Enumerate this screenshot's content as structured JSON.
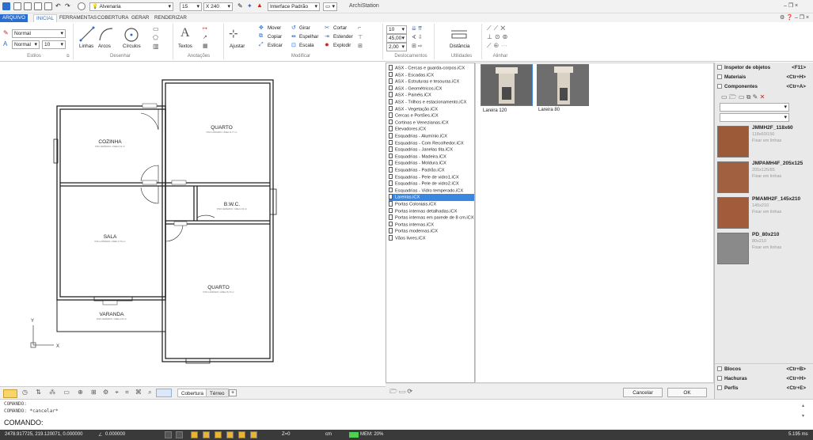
{
  "title": {
    "app": "ArchiStation",
    "layer": "Alvenaria",
    "thickness": "15",
    "height": "240",
    "interface": "Interface Padrão",
    "window_controls": "– ❐ ×"
  },
  "menu": {
    "file": "ARQUIVO",
    "tabs": [
      "INICIAL",
      "FERRAMENTAS",
      "COBERTURA",
      "GERAR",
      "RENDERIZAR"
    ]
  },
  "ribbon": {
    "styles": {
      "style1": "Normal",
      "style2": "Normal",
      "size": "10",
      "label": "Estilos"
    },
    "desenhar": {
      "linhas": "Linhas",
      "arcos": "Arcos",
      "circulos": "Círculos",
      "label": "Desenhar"
    },
    "anotacoes": {
      "textos": "Textos",
      "label": "Anotações"
    },
    "modificar": {
      "ajustar": "Ajustar",
      "mover": "Mover",
      "copiar": "Copiar",
      "esticar": "Esticar",
      "girar": "Girar",
      "espelhar": "Espelhar",
      "escala": "Escala",
      "cortar": "Cortar",
      "estender": "Estender",
      "explodir": "Explodir",
      "label": "Modificar"
    },
    "deslocamentos": {
      "v1": "10",
      "v2": "45,00",
      "v3": "2,00",
      "label": "Deslocamentos"
    },
    "utilidades": {
      "distancia": "Distância",
      "label": "Utilidades"
    },
    "alinhar": {
      "label": "Alinhar"
    }
  },
  "plan": {
    "rooms": {
      "cozinha": {
        "name": "COZINHA",
        "info": "PISO CERÂMICO / ÁREA 8,11 m²"
      },
      "quarto1": {
        "name": "QUARTO",
        "info": "PISO LAMINADO / ÁREA 11,77 m²"
      },
      "bwc": {
        "name": "B.W.C.",
        "info": "PISO CERÂMICO / ÁREA 2,30 m²"
      },
      "sala": {
        "name": "SALA",
        "info": "PISO LAMINADO / ÁREA 17,51 m²"
      },
      "quarto2": {
        "name": "QUARTO",
        "info": "PISO LAMINADO / ÁREA 15,74 m²"
      },
      "varanda": {
        "name": "VARANDA",
        "info": "PISO CERÂMICO / ÁREA 4,53 m²"
      }
    },
    "axis": {
      "x": "X",
      "y": "Y"
    }
  },
  "files": [
    "ASX - Cercas e guarda-corpos.iCX",
    "ASX - Escadas.iCX",
    "ASX - Estruturas e tesouras.iCX",
    "ASX - Geométricos.iCX",
    "ASX - Painéis.iCX",
    "ASX - Trilhos e estacionamento.iCX",
    "ASX - Vegetação.iCX",
    "Cercas e Portões.iCX",
    "Cortinas e Venezianas.iCX",
    "Elevadores.iCX",
    "Esquadrias - Alumínio.iCX",
    "Esquadrias - Com Recolhedor.iCX",
    "Esquadrias - Janelas tita.iCX",
    "Esquadrias - Madeira.iCX",
    "Esquadrias - Moldura.iCX",
    "Esquadrias - Padrão.iCX",
    "Esquadrias - Pele de vidro1.iCX",
    "Esquadrias - Pele de vidro2.iCX",
    "Esquadrias - Vidro temperado.iCX",
    "Lareiras.iCX",
    "Portas Coloniais.iCX",
    "Portas internas detalhadas.iCX",
    "Portas internas em parede de 8 cm.iCX",
    "Portas internas.iCX",
    "Portas modernas.iCX",
    "Vãos livres.iCX"
  ],
  "selected_file_index": 19,
  "thumbnails": [
    {
      "name": "Lareira 120"
    },
    {
      "name": "Lareira 80"
    }
  ],
  "dialog": {
    "cancel": "Cancelar",
    "ok": "OK"
  },
  "right_panel": {
    "top": [
      {
        "label": "Inspetor de objetos",
        "key": "<F11>"
      },
      {
        "label": "Materiais",
        "key": "<Ctr+H>"
      },
      {
        "label": "Componentes",
        "key": "<Ctr+A>"
      }
    ],
    "components": [
      {
        "name": "JMMH2F_118x60",
        "size": "118x60/150",
        "desc": "Fixar em linhas"
      },
      {
        "name": "JMPAMH4F_205x125",
        "size": "205x125/85",
        "desc": "Fixar em linhas"
      },
      {
        "name": "PMAMH2F_145x210",
        "size": "145x210",
        "desc": "Fixar em linhas"
      },
      {
        "name": "PD_80x210",
        "size": "80x210",
        "desc": "Fixar em linhas"
      }
    ],
    "bottom": [
      {
        "label": "Blocos",
        "key": "<Ctr+B>"
      },
      {
        "label": "Hachuras",
        "key": "<Ctr+H>"
      },
      {
        "label": "Perfis",
        "key": "<Ctr+E>"
      }
    ]
  },
  "bottom_tabs": {
    "cobertura": "Cobertura",
    "terreo": "Térreo"
  },
  "command": {
    "line1": "COMANDO:",
    "line2": "COMANDO: *cancelar*",
    "prompt": "COMANDO:"
  },
  "status": {
    "coords": "2478.917725, 219.120071, 0.000000",
    "angle": "0.000000",
    "z": "Z=0",
    "unit": "cm",
    "mem": "MEM: 20%",
    "time": "5.195 ms"
  },
  "colors": {
    "accent": "#2a6fd0",
    "selection": "#3b87e0",
    "status_bg": "#3a3a3a"
  }
}
